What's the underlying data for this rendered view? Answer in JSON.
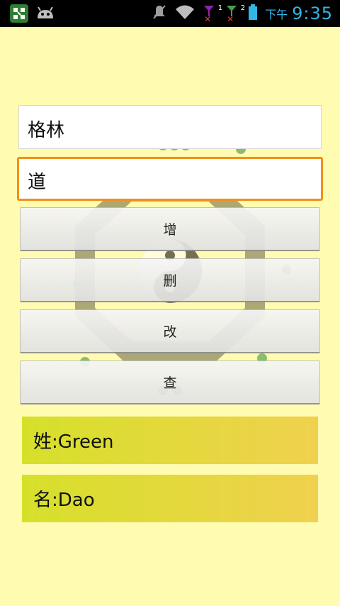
{
  "statusbar": {
    "ampm": "下午",
    "time": "9:35",
    "sim1_index": "1",
    "sim2_index": "2"
  },
  "form": {
    "surname_value": "格林",
    "givenname_value": "道"
  },
  "buttons": {
    "add": "增",
    "delete": "删",
    "update": "改",
    "query": "查"
  },
  "results": {
    "surname_line": "姓:Green",
    "givenname_line": "名:Dao"
  },
  "colors": {
    "background": "#fffbb0",
    "focus_border": "#f0901a",
    "time_color": "#33b5e5",
    "result_gradient_start": "#d6e02a",
    "result_gradient_end": "#f0d14e"
  },
  "icons": [
    "app-launcher-icon",
    "android-robot-icon",
    "mute-icon",
    "wifi-icon",
    "sim1-signal-icon",
    "sim2-signal-icon",
    "battery-icon",
    "bagua-emblem"
  ]
}
